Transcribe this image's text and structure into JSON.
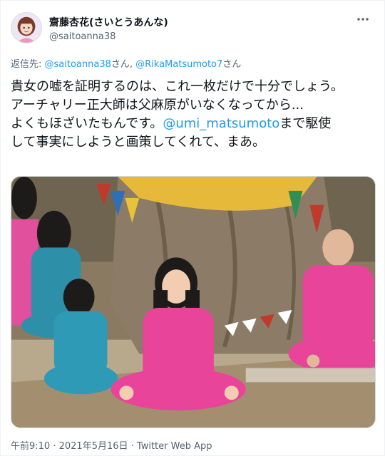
{
  "author": {
    "display_name": "齋藤杏花(さいとうあんな)",
    "handle": "@saitoanna38"
  },
  "reply_to": {
    "prefix": "返信先: ",
    "mention1": "@saitoanna38",
    "sep1": "さん, ",
    "mention2": "@RikaMatsumoto7",
    "sep2": "さん"
  },
  "tweet": {
    "line1": "貴女の嘘を証明するのは、これ一枚だけで十分でしょう。",
    "line2": "アーチャリー正大師は父麻原がいなくなってから...",
    "line3_prefix": "よくもほざいたもんです。",
    "line3_mention": "@umi_matsumoto",
    "line3_suffix": "まで駆使",
    "line4": "して事実にしようと画策してくれて、まあ。"
  },
  "meta": {
    "time": "午前9:10",
    "sep": " · ",
    "date": "2021年5月16日",
    "app": "Twitter Web App"
  },
  "icons": {
    "more": "more-horizontal-icon",
    "avatar": "avatar-illustration"
  },
  "colors": {
    "link": "#1d9bf0",
    "secondary": "#536471",
    "robe_pink": "#e8449a",
    "robe_teal": "#2e8fa8",
    "cloth_yellow": "#e6b93a"
  }
}
